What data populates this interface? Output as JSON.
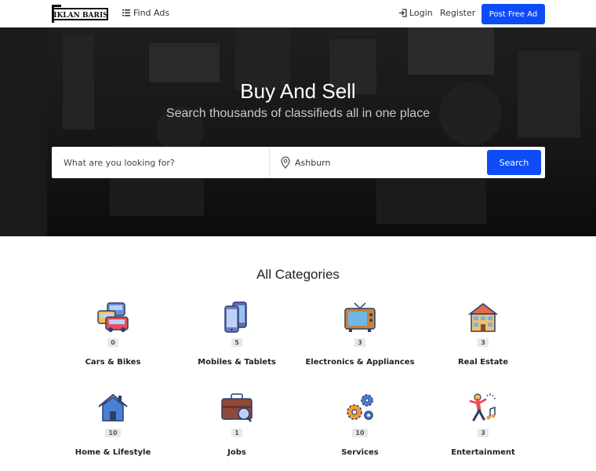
{
  "nav": {
    "logo_text": "IKLAN BARIS",
    "find_ads": "Find Ads",
    "login": "Login",
    "register": "Register",
    "post_ad": "Post Free Ad"
  },
  "hero": {
    "title": "Buy And Sell",
    "subtitle": "Search thousands of classifieds all in one place"
  },
  "search": {
    "placeholder": "What are you looking for?",
    "location_value": "Ashburn",
    "button": "Search"
  },
  "categories": {
    "title": "All Categories",
    "items": [
      {
        "name": "Cars & Bikes",
        "count": "0",
        "icon": "car-icon"
      },
      {
        "name": "Mobiles & Tablets",
        "count": "5",
        "icon": "mobile-icon"
      },
      {
        "name": "Electronics & Appliances",
        "count": "3",
        "icon": "tv-icon"
      },
      {
        "name": "Real Estate",
        "count": "3",
        "icon": "building-icon"
      },
      {
        "name": "Home & Lifestyle",
        "count": "10",
        "icon": "home-icon"
      },
      {
        "name": "Jobs",
        "count": "1",
        "icon": "briefcase-icon"
      },
      {
        "name": "Services",
        "count": "10",
        "icon": "gears-icon"
      },
      {
        "name": "Entertainment",
        "count": "3",
        "icon": "dancer-icon"
      }
    ]
  },
  "colors": {
    "primary": "#0d4cf7",
    "hero_bg": "#151515"
  }
}
